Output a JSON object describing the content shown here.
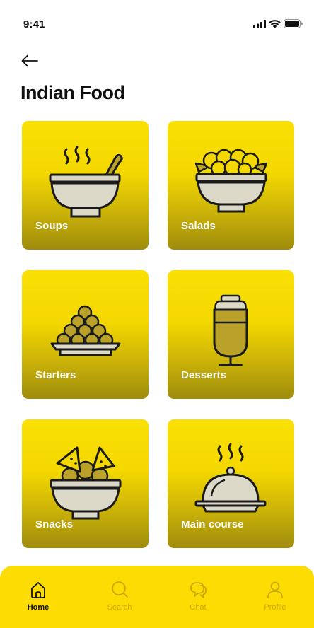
{
  "status": {
    "time": "9:41"
  },
  "header": {
    "title": "Indian Food"
  },
  "categories": [
    {
      "label": "Soups",
      "icon": "soup-bowl-icon"
    },
    {
      "label": "Salads",
      "icon": "salad-bowl-icon"
    },
    {
      "label": "Starters",
      "icon": "starters-plate-icon"
    },
    {
      "label": "Desserts",
      "icon": "dessert-glass-icon"
    },
    {
      "label": "Snacks",
      "icon": "snacks-bowl-icon"
    },
    {
      "label": "Main course",
      "icon": "cloche-icon"
    }
  ],
  "nav": {
    "home": "Home",
    "search": "Search",
    "chat": "Chat",
    "profile": "Profile"
  },
  "colors": {
    "accent": "#fddc04",
    "card_top": "#fae005",
    "card_bottom": "#9f8c0c",
    "inactive_nav": "#c9a900"
  }
}
